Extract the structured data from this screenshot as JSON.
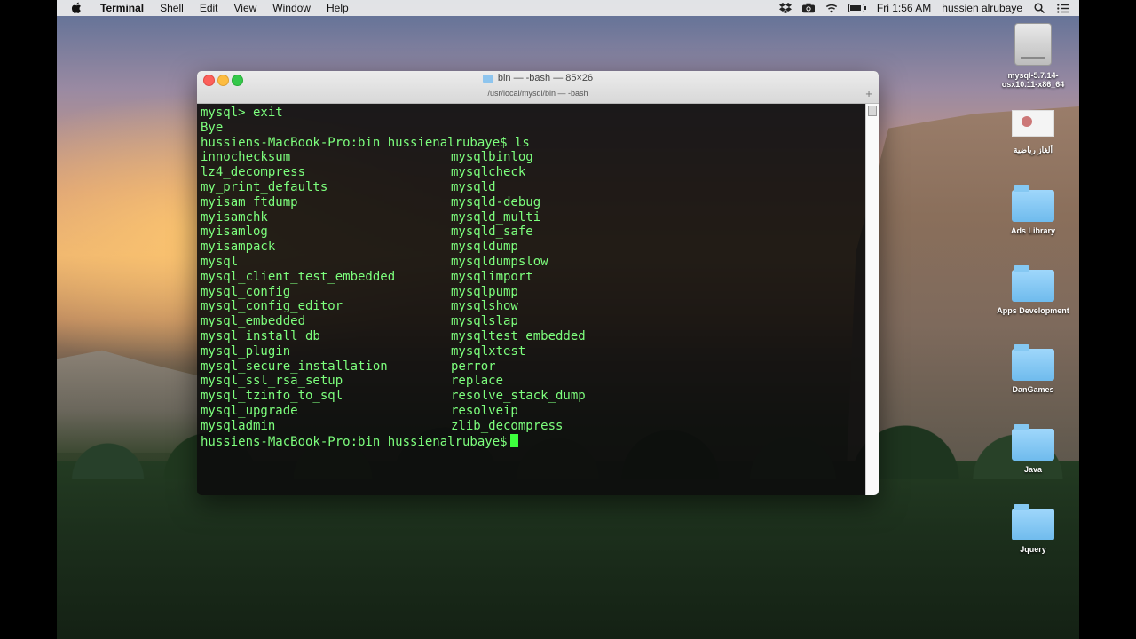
{
  "menubar": {
    "app": "Terminal",
    "items": [
      "Shell",
      "Edit",
      "View",
      "Window",
      "Help"
    ],
    "clock": "Fri 1:56 AM",
    "user": "hussien alrubaye"
  },
  "terminal": {
    "title": "bin — -bash — 85×26",
    "tab_path": "/usr/local/mysql/bin — -bash",
    "lines_top": [
      "mysql> exit",
      "Bye",
      "hussiens-MacBook-Pro:bin hussienalrubaye$ ls"
    ],
    "listing_left": [
      "innochecksum",
      "lz4_decompress",
      "my_print_defaults",
      "myisam_ftdump",
      "myisamchk",
      "myisamlog",
      "myisampack",
      "mysql",
      "mysql_client_test_embedded",
      "mysql_config",
      "mysql_config_editor",
      "mysql_embedded",
      "mysql_install_db",
      "mysql_plugin",
      "mysql_secure_installation",
      "mysql_ssl_rsa_setup",
      "mysql_tzinfo_to_sql",
      "mysql_upgrade",
      "mysqladmin"
    ],
    "listing_right": [
      "mysqlbinlog",
      "mysqlcheck",
      "mysqld",
      "mysqld-debug",
      "mysqld_multi",
      "mysqld_safe",
      "mysqldump",
      "mysqldumpslow",
      "mysqlimport",
      "mysqlpump",
      "mysqlshow",
      "mysqlslap",
      "mysqltest_embedded",
      "mysqlxtest",
      "perror",
      "replace",
      "resolve_stack_dump",
      "resolveip",
      "zlib_decompress"
    ],
    "prompt": "hussiens-MacBook-Pro:bin hussienalrubaye$"
  },
  "desktop": {
    "disk_label": "mysql-5.7.14-osx10.11-x86_64",
    "image_label": "ألغاز رياضية",
    "folders": [
      "Ads Library",
      "Apps Development",
      "DanGames",
      "Java",
      "Jquery"
    ]
  }
}
